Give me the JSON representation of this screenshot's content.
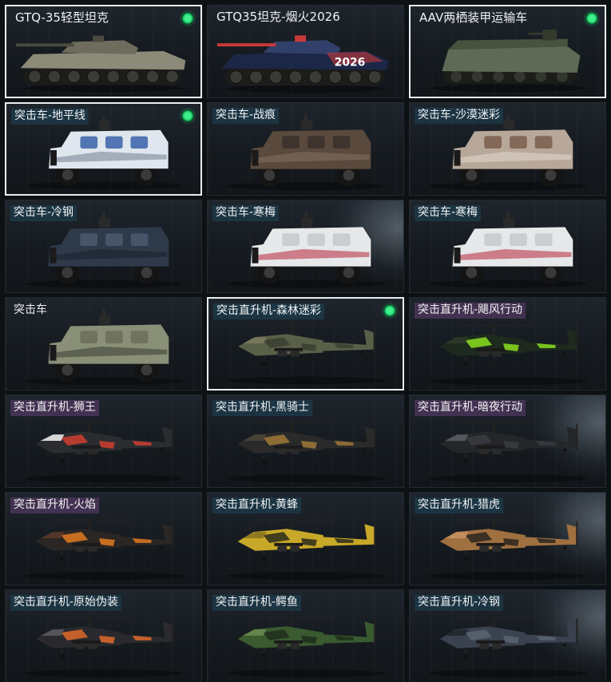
{
  "items": [
    {
      "name": "GTQ-35轻型坦克",
      "type": "tank",
      "selected": true,
      "badge": true,
      "label_style": "plain",
      "colors": [
        "#8c8a78",
        "#6e6c5c",
        "#4a4a40"
      ]
    },
    {
      "name": "GTQ35坦克-烟火2026",
      "type": "tank",
      "selected": false,
      "badge": false,
      "label_style": "plain",
      "colors": [
        "#1c2747",
        "#31406a",
        "#c83a3a"
      ],
      "decal": "2026"
    },
    {
      "name": "AAV两栖装甲运输车",
      "type": "amphibious",
      "selected": true,
      "badge": true,
      "label_style": "plain",
      "colors": [
        "#5e6a55",
        "#48523f",
        "#33392c"
      ]
    },
    {
      "name": "突击车-地平线",
      "type": "assault",
      "selected": true,
      "badge": true,
      "label_style": "teal",
      "colors": [
        "#dfe6ee",
        "#3a62a8",
        "#8a96a5"
      ]
    },
    {
      "name": "突击车-战痕",
      "type": "assault",
      "selected": false,
      "badge": false,
      "label_style": "teal",
      "colors": [
        "#5a4a3e",
        "#3a302a",
        "#7a6a5a"
      ]
    },
    {
      "name": "突击车-沙漠迷彩",
      "type": "assault",
      "selected": false,
      "badge": false,
      "label_style": "teal",
      "colors": [
        "#b8a89a",
        "#7a5e4e",
        "#d9cfc4"
      ]
    },
    {
      "name": "突击车-冷钢",
      "type": "assault",
      "selected": false,
      "badge": false,
      "label_style": "teal",
      "colors": [
        "#2e3a4a",
        "#4a5a70",
        "#1e2630"
      ]
    },
    {
      "name": "突击车-寒梅",
      "type": "assault",
      "selected": false,
      "badge": false,
      "label_style": "teal",
      "colors": [
        "#e6e8ea",
        "#c4c8cc",
        "#c05060"
      ],
      "glow": true
    },
    {
      "name": "突击车-寒梅",
      "type": "assault",
      "selected": false,
      "badge": false,
      "label_style": "teal",
      "colors": [
        "#e6e8ea",
        "#c4c8cc",
        "#c05060"
      ]
    },
    {
      "name": "突击车",
      "type": "assault",
      "selected": false,
      "badge": false,
      "label_style": "plain",
      "colors": [
        "#8a8f78",
        "#6a6f5a",
        "#4a4e40"
      ]
    },
    {
      "name": "突击直升机-森林迷彩",
      "type": "heli",
      "selected": true,
      "badge": true,
      "label_style": "teal",
      "colors": [
        "#5a6048",
        "#3a3e30",
        "#7a7a60"
      ]
    },
    {
      "name": "突击直升机-飓风行动",
      "type": "heli",
      "selected": false,
      "badge": false,
      "label_style": "purple",
      "colors": [
        "#1e2a1e",
        "#8adf20",
        "#2c3a2a"
      ]
    },
    {
      "name": "突击直升机-狮王",
      "type": "heli",
      "selected": false,
      "badge": false,
      "label_style": "purple",
      "colors": [
        "#2a2c30",
        "#d04030",
        "#e8e8e8"
      ]
    },
    {
      "name": "突击直升机-黑骑士",
      "type": "heli",
      "selected": false,
      "badge": false,
      "label_style": "teal",
      "colors": [
        "#2a2a2a",
        "#a07838",
        "#4a4238"
      ]
    },
    {
      "name": "突击直升机-暗夜行动",
      "type": "heli",
      "selected": false,
      "badge": false,
      "label_style": "purple",
      "colors": [
        "#24262a",
        "#3a3c42",
        "#5a5c62"
      ],
      "glow": true
    },
    {
      "name": "突击直升机-火焰",
      "type": "heli",
      "selected": false,
      "badge": false,
      "label_style": "purple",
      "colors": [
        "#2a2624",
        "#e07a20",
        "#5a3a2a"
      ]
    },
    {
      "name": "突击直升机-黄蜂",
      "type": "heli",
      "selected": false,
      "badge": false,
      "label_style": "teal",
      "colors": [
        "#c8a828",
        "#2a2a1a",
        "#8a7420"
      ]
    },
    {
      "name": "突击直升机-猎虎",
      "type": "heli",
      "selected": false,
      "badge": false,
      "label_style": "teal",
      "colors": [
        "#a07040",
        "#2a2420",
        "#c89060"
      ],
      "glow": true
    },
    {
      "name": "突击直升机-原始伪装",
      "type": "heli",
      "selected": false,
      "badge": false,
      "label_style": "teal",
      "colors": [
        "#2a2a2e",
        "#e06a2a",
        "#5a5a60"
      ]
    },
    {
      "name": "突击直升机-鳄鱼",
      "type": "heli",
      "selected": false,
      "badge": false,
      "label_style": "teal",
      "colors": [
        "#3a5a30",
        "#1e2e1a",
        "#6a8a50"
      ]
    },
    {
      "name": "突击直升机-冷钢",
      "type": "heli",
      "selected": false,
      "badge": false,
      "label_style": "teal",
      "colors": [
        "#3a4250",
        "#5a6470",
        "#22272e"
      ],
      "glow": true
    }
  ]
}
